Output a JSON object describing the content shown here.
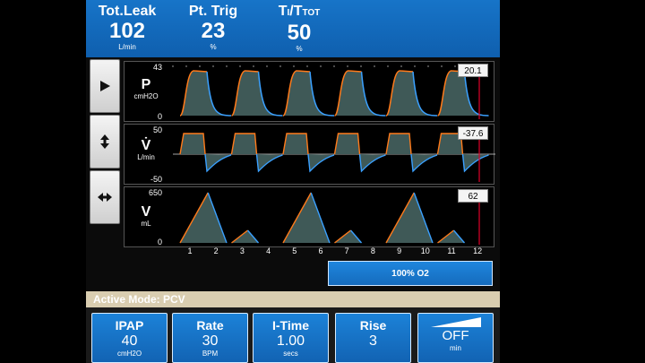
{
  "header": {
    "leak": {
      "label": "Tot.Leak",
      "value": "102",
      "unit": "L/min"
    },
    "trig": {
      "label": "Pt. Trig",
      "value": "23",
      "unit": "%"
    },
    "ti": {
      "label_main": "T",
      "label_sub1": "I",
      "label_slash": "/T",
      "label_sub2": "TOT",
      "value": "50",
      "unit": "%"
    }
  },
  "side_buttons": [
    {
      "icon": "play-icon"
    },
    {
      "icon": "vertical-arrows-icon"
    },
    {
      "icon": "horizontal-arrows-icon"
    }
  ],
  "panels": {
    "pressure": {
      "name": "P",
      "unit": "cmH2O",
      "ymax": "43",
      "ymin": "0",
      "readout": "20.1"
    },
    "flow": {
      "name": "V̇",
      "unit": "L/min",
      "ymax": "50",
      "ymin": "-50",
      "readout": "-37.6"
    },
    "volume": {
      "name": "V",
      "unit": "mL",
      "ymax": "650",
      "ymin": "0",
      "readout": "62"
    }
  },
  "x_ticks": [
    "1",
    "2",
    "3",
    "4",
    "5",
    "6",
    "7",
    "8",
    "9",
    "10",
    "11",
    "12"
  ],
  "o2_button": "100% O2",
  "mode_bar": "Active Mode: PCV",
  "settings": [
    {
      "label": "IPAP",
      "value": "40",
      "unit": "cmH2O"
    },
    {
      "label": "Rate",
      "value": "30",
      "unit": "BPM"
    },
    {
      "label": "I-Time",
      "value": "1.00",
      "unit": "secs"
    },
    {
      "label": "Rise",
      "value": "3",
      "unit": ""
    },
    {
      "label": "",
      "value": "OFF",
      "unit": "min"
    }
  ],
  "colors": {
    "header_blue": "#1670c4",
    "button_blue": "#1877cf",
    "mode_bar": "#d9cdb0",
    "wave_orange": "#ff7a1a",
    "wave_blue": "#3aa0ff",
    "wave_fill": "#3f5957",
    "cursor": "#e0002a"
  }
}
